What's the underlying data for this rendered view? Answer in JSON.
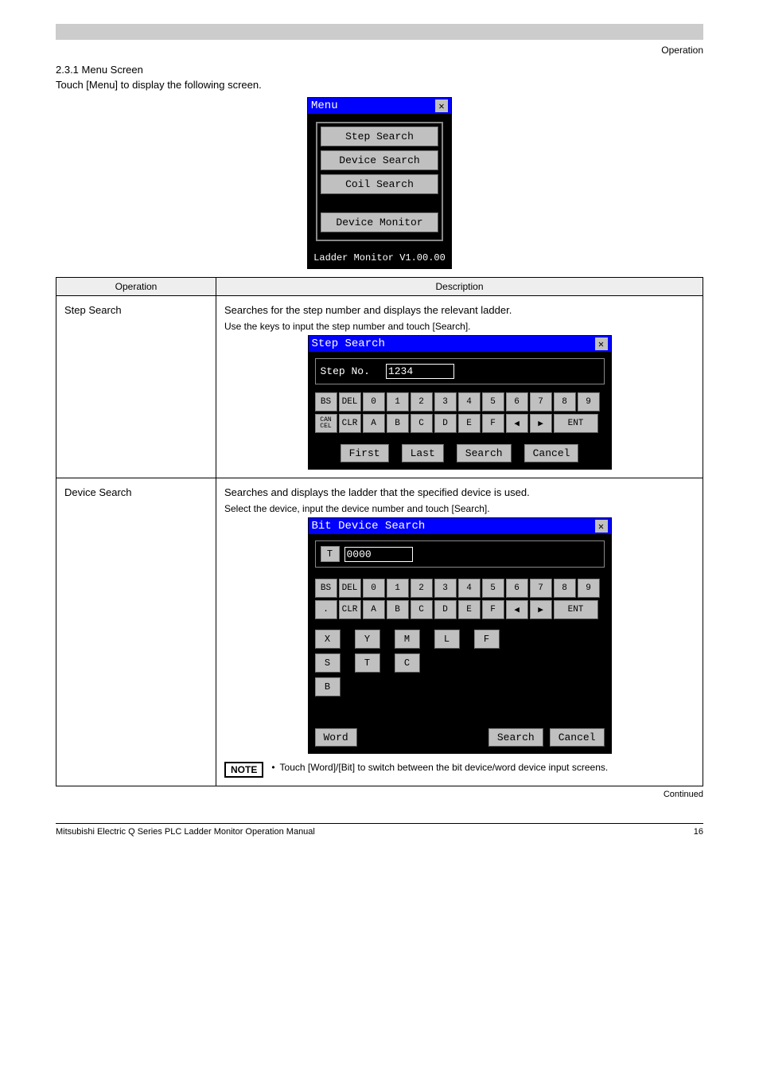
{
  "header": {
    "right_text": "Operation"
  },
  "section": {
    "num_title": "2.3.1 Menu Screen",
    "intro": "Touch [Menu] to display the following screen."
  },
  "menu_dialog": {
    "title": "Menu",
    "items": [
      "Step Search",
      "Device Search",
      "Coil Search",
      "Device Monitor"
    ],
    "footer": "Ladder Monitor V1.00.00"
  },
  "table": {
    "headers": [
      "Operation",
      "Description"
    ],
    "step_search": {
      "left": "Step Search",
      "desc": "Searches for the step number and displays the relevant ladder.",
      "sub": "Use the keys to input the step number and touch [Search].",
      "dlg_title": "Step Search",
      "field_label": "Step No.",
      "field_value": "1234",
      "keys_row1": [
        "BS",
        "DEL",
        "0",
        "1",
        "2",
        "3",
        "4",
        "5",
        "6",
        "7",
        "8",
        "9"
      ],
      "keys_row2": [
        "CAN CEL",
        "CLR",
        "A",
        "B",
        "C",
        "D",
        "E",
        "F",
        "◀",
        "▶",
        "ENT"
      ],
      "buttons": [
        "First",
        "Last",
        "Search",
        "Cancel"
      ]
    },
    "device_search": {
      "left": "Device Search",
      "desc": "Searches and displays the ladder that the specified device is used.",
      "sub": "Select the device, input the device number and touch [Search].",
      "dlg_title": "Bit Device Search",
      "prefix": "T",
      "field_value": "0000",
      "keys_row1": [
        "BS",
        "DEL",
        "0",
        "1",
        "2",
        "3",
        "4",
        "5",
        "6",
        "7",
        "8",
        "9"
      ],
      "keys_row2": [
        ".",
        "CLR",
        "A",
        "B",
        "C",
        "D",
        "E",
        "F",
        "◀",
        "▶",
        "ENT"
      ],
      "cat_row1": [
        "X",
        "Y",
        "M",
        "L",
        "F"
      ],
      "cat_row2": [
        "S",
        "T",
        "C"
      ],
      "cat_row3": [
        "B"
      ],
      "word_btn": "Word",
      "buttons": [
        "Search",
        "Cancel"
      ],
      "note_label": "NOTE",
      "note_text": "Touch [Word]/[Bit] to switch between the bit device/word device input screens."
    }
  },
  "continued": "Continued",
  "footer": {
    "left": "Mitsubishi Electric Q Series PLC Ladder Monitor Operation Manual",
    "right": "16"
  }
}
